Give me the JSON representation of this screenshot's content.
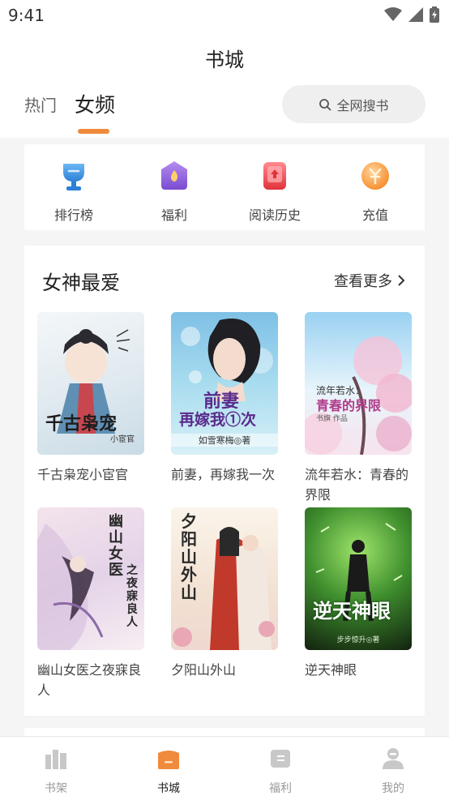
{
  "status": {
    "time": "9:41"
  },
  "header": {
    "title": "书城",
    "tabs": [
      {
        "label": "热门"
      },
      {
        "label": "女频"
      }
    ],
    "search_label": "全网搜书"
  },
  "quick_actions": [
    {
      "label": "排行榜",
      "icon": "trophy-icon",
      "color": "#3f8fe0"
    },
    {
      "label": "福利",
      "icon": "gift-icon",
      "color": "#8a5bd6"
    },
    {
      "label": "阅读历史",
      "icon": "history-icon",
      "color": "#e8454f"
    },
    {
      "label": "充值",
      "icon": "coin-icon",
      "color": "#f59a3a"
    }
  ],
  "section": {
    "title": "女神最爱",
    "more_label": "查看更多",
    "books": [
      {
        "title": "千古枭宠小宦官",
        "cover_text": "千古枭宠",
        "cover_sub": "小宦官"
      },
      {
        "title": "前妻，再嫁我一次",
        "cover_text": "前妻",
        "cover_sub": "再嫁我①次",
        "cover_author": "如雪寒梅◎著"
      },
      {
        "title": "流年若水：青春的界限",
        "cover_text": "流年若水：",
        "cover_sub": "青春的界限",
        "cover_author": "书旗 作品"
      },
      {
        "title": "幽山女医之夜寐良人",
        "cover_text": "幽山女医",
        "cover_sub": "之夜寐良人"
      },
      {
        "title": "夕阳山外山",
        "cover_text": "夕阳山外山"
      },
      {
        "title": "逆天神眼",
        "cover_text": "逆天神眼",
        "cover_author": "步步惊升◎著"
      }
    ]
  },
  "tabbar": [
    {
      "label": "书架",
      "icon": "bookshelf-icon",
      "active": false
    },
    {
      "label": "书城",
      "icon": "bookstore-icon",
      "active": true
    },
    {
      "label": "福利",
      "icon": "welfare-icon",
      "active": false
    },
    {
      "label": "我的",
      "icon": "profile-icon",
      "active": false
    }
  ],
  "colors": {
    "accent": "#f08a3c",
    "tab_inactive": "#999999"
  }
}
